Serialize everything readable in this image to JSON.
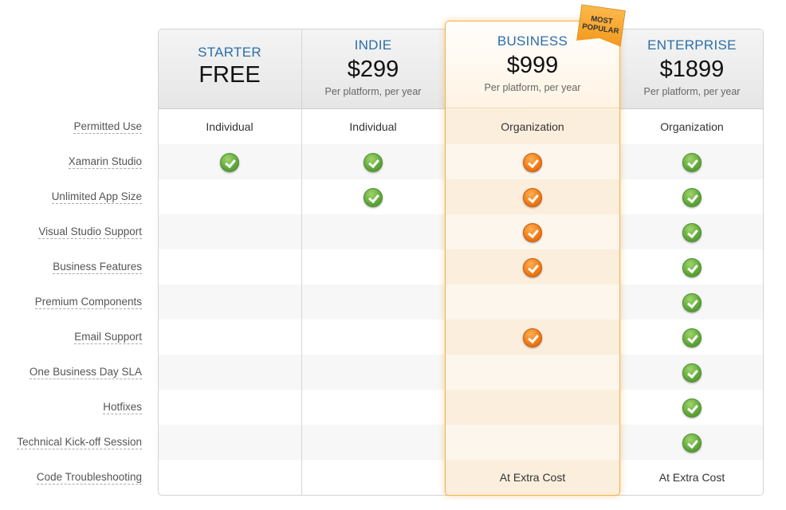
{
  "plans": [
    {
      "name": "STARTER",
      "price": "FREE",
      "subtitle": ""
    },
    {
      "name": "INDIE",
      "price": "$299",
      "subtitle": "Per platform, per year"
    },
    {
      "name": "BUSINESS",
      "price": "$999",
      "subtitle": "Per platform, per year"
    },
    {
      "name": "ENTERPRISE",
      "price": "$1899",
      "subtitle": "Per platform, per year"
    }
  ],
  "badge": {
    "line1": "MOST",
    "line2": "POPULAR"
  },
  "features": [
    {
      "label": "Permitted Use",
      "values": [
        "Individual",
        "Individual",
        "Organization",
        "Organization"
      ]
    },
    {
      "label": "Xamarin Studio",
      "values": [
        "check",
        "check",
        "check",
        "check"
      ]
    },
    {
      "label": "Unlimited App Size",
      "values": [
        "",
        "check",
        "check",
        "check"
      ]
    },
    {
      "label": "Visual Studio Support",
      "values": [
        "",
        "",
        "check",
        "check"
      ]
    },
    {
      "label": "Business Features",
      "values": [
        "",
        "",
        "check",
        "check"
      ]
    },
    {
      "label": "Premium Components",
      "values": [
        "",
        "",
        "",
        "check"
      ]
    },
    {
      "label": "Email Support",
      "values": [
        "",
        "",
        "check",
        "check"
      ]
    },
    {
      "label": "One Business Day SLA",
      "values": [
        "",
        "",
        "",
        "check"
      ]
    },
    {
      "label": "Hotfixes",
      "values": [
        "",
        "",
        "",
        "check"
      ]
    },
    {
      "label": "Technical Kick-off Session",
      "values": [
        "",
        "",
        "",
        "check"
      ]
    },
    {
      "label": "Code Troubleshooting",
      "values": [
        "",
        "",
        "At Extra Cost",
        "At Extra Cost"
      ]
    }
  ],
  "colors": {
    "accent": "#2b6ea8",
    "check_green": "#5ea63a",
    "check_orange": "#ef7a14",
    "highlight_border": "#f0b24a"
  }
}
